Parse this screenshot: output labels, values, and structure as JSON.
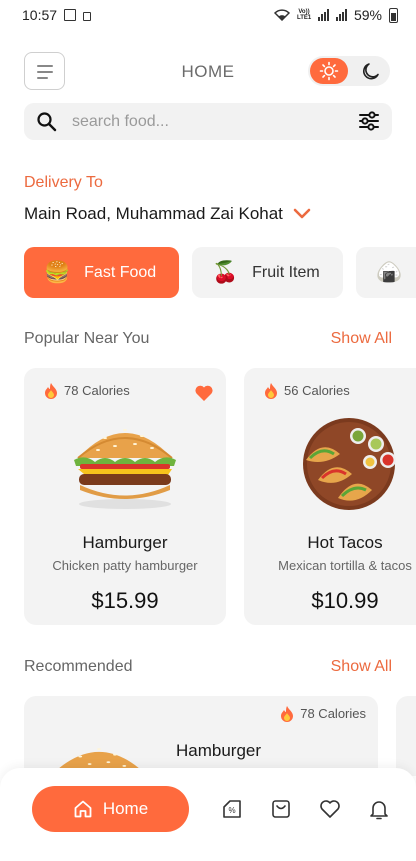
{
  "status_bar": {
    "time": "10:57",
    "battery": "59%",
    "network_label": "Vo)) LTE1"
  },
  "header": {
    "title": "HOME"
  },
  "search": {
    "placeholder": "search food..."
  },
  "delivery": {
    "label": "Delivery To",
    "address": "Main Road, Muhammad Zai Kohat"
  },
  "categories": [
    {
      "label": "Fast Food",
      "emoji": "🍔",
      "active": true
    },
    {
      "label": "Fruit Item",
      "emoji": "🍒",
      "active": false
    },
    {
      "label": "",
      "emoji": "🍙",
      "active": false
    }
  ],
  "popular": {
    "title": "Popular Near You",
    "show_all": "Show All",
    "items": [
      {
        "calories": "78 Calories",
        "name": "Hamburger",
        "description": "Chicken patty hamburger",
        "price": "$15.99",
        "favorite": true
      },
      {
        "calories": "56 Calories",
        "name": "Hot Tacos",
        "description": "Mexican tortilla & tacos",
        "price": "$10.99",
        "favorite": false
      }
    ]
  },
  "recommended": {
    "title": "Recommended",
    "show_all": "Show All",
    "items": [
      {
        "calories": "78 Calories",
        "name": "Hamburger"
      }
    ]
  },
  "bottom_nav": {
    "home_label": "Home"
  },
  "colors": {
    "accent": "#ff6a3d",
    "accent_text": "#ec6a3f",
    "card_bg": "#f3f3f3"
  }
}
